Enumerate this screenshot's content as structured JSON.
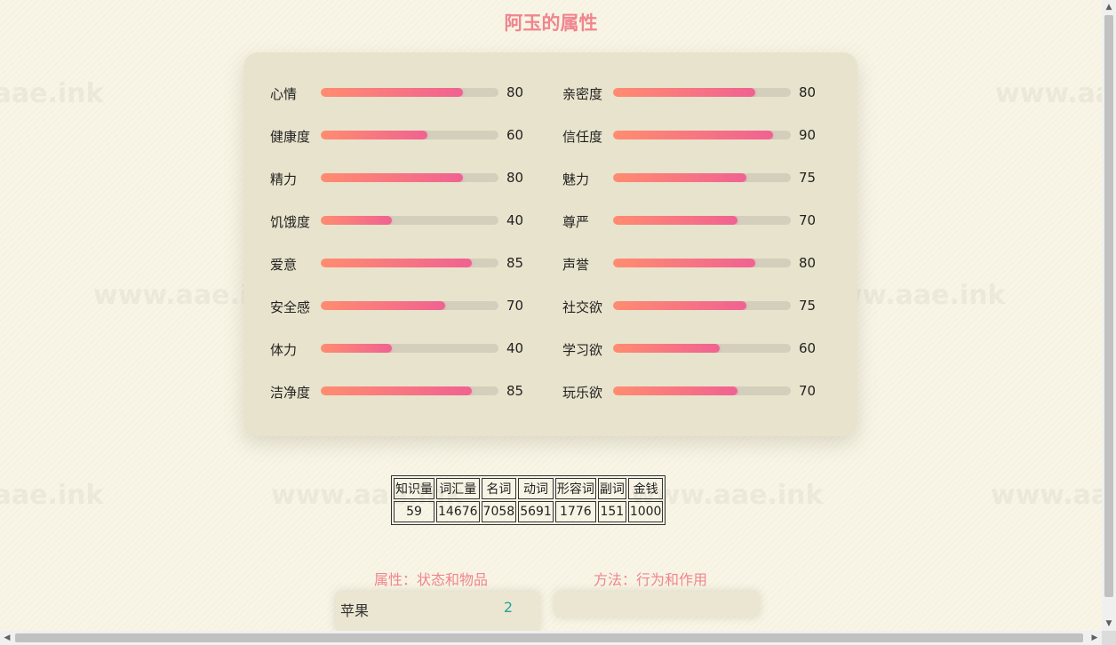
{
  "page": {
    "title": "阿玉的属性"
  },
  "watermark": "www.aae.ink",
  "colors": {
    "accent": "#f0858e",
    "bar_start": "#ff8c70",
    "bar_end": "#f06292",
    "count": "#26a69a"
  },
  "stats": {
    "left": [
      {
        "label": "心情",
        "value": "80"
      },
      {
        "label": "健康度",
        "value": "60"
      },
      {
        "label": "精力",
        "value": "80"
      },
      {
        "label": "饥饿度",
        "value": "40"
      },
      {
        "label": "爱意",
        "value": "85"
      },
      {
        "label": "安全感",
        "value": "70"
      },
      {
        "label": "体力",
        "value": "40"
      },
      {
        "label": "洁净度",
        "value": "85"
      }
    ],
    "right": [
      {
        "label": "亲密度",
        "value": "80"
      },
      {
        "label": "信任度",
        "value": "90"
      },
      {
        "label": "魅力",
        "value": "75"
      },
      {
        "label": "尊严",
        "value": "70"
      },
      {
        "label": "声誉",
        "value": "80"
      },
      {
        "label": "社交欲",
        "value": "75"
      },
      {
        "label": "学习欲",
        "value": "60"
      },
      {
        "label": "玩乐欲",
        "value": "70"
      }
    ]
  },
  "vocab_table": {
    "headers": [
      "知识量",
      "词汇量",
      "名词",
      "动词",
      "形容词",
      "副词",
      "金钱"
    ],
    "values": [
      "59",
      "14676",
      "7058",
      "5691",
      "1776",
      "151",
      "1000"
    ]
  },
  "sections": {
    "attributes_title": "属性：状态和物品",
    "methods_title": "方法：行为和作用"
  },
  "inventory": [
    {
      "name": "苹果",
      "count": "2"
    }
  ],
  "icons": {
    "scroll_up": "scroll-up-arrow-icon",
    "scroll_down": "scroll-down-arrow-icon",
    "scroll_left": "scroll-left-arrow-icon",
    "scroll_right": "scroll-right-arrow-icon"
  }
}
